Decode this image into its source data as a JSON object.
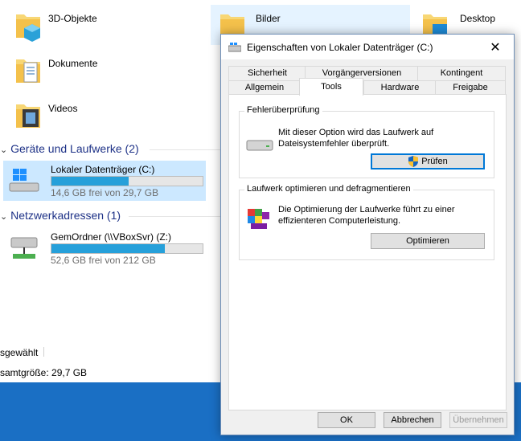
{
  "explorer": {
    "folders": [
      {
        "name": "3D-Objekte",
        "icon": "3d-objects-folder-icon"
      },
      {
        "name": "Bilder",
        "icon": "pictures-folder-icon"
      },
      {
        "name": "Desktop",
        "icon": "desktop-folder-icon"
      },
      {
        "name": "Dokumente",
        "icon": "documents-folder-icon"
      },
      {
        "name": "Videos",
        "icon": "videos-folder-icon"
      }
    ],
    "devices_group": "Geräte und Laufwerke (2)",
    "network_group": "Netzwerkadressen (1)",
    "drives": [
      {
        "name": "Lokaler Datenträger (C:)",
        "free": "14,6 GB frei von 29,7 GB",
        "used_fraction": 0.51,
        "selected": true
      },
      {
        "name": "GemOrdner (\\\\VBoxSvr) (Z:)",
        "free": "52,6 GB frei von 212 GB",
        "used_fraction": 0.75,
        "selected": false
      }
    ],
    "status_selected": "sgewählt",
    "status_size": "samtgröße: 29,7 GB",
    "accent": "#26a0da",
    "taskbar_color": "#1a6fc4"
  },
  "dialog": {
    "title": "Eigenschaften von Lokaler Datenträger (C:)",
    "tabs_row1": [
      "Sicherheit",
      "Vorgängerversionen",
      "Kontingent"
    ],
    "tabs_row2": [
      "Allgemein",
      "Tools",
      "Hardware",
      "Freigabe"
    ],
    "active_tab": "Tools",
    "error_check": {
      "title": "Fehlerüberprüfung",
      "text": "Mit dieser Option wird das Laufwerk auf Dateisystemfehler überprüft.",
      "button": "Prüfen"
    },
    "optimize": {
      "title": "Laufwerk optimieren und defragmentieren",
      "text": "Die Optimierung der Laufwerke führt zu einer effizienteren Computerleistung.",
      "button": "Optimieren"
    },
    "ok": "OK",
    "cancel": "Abbrechen",
    "apply": "Übernehmen"
  }
}
